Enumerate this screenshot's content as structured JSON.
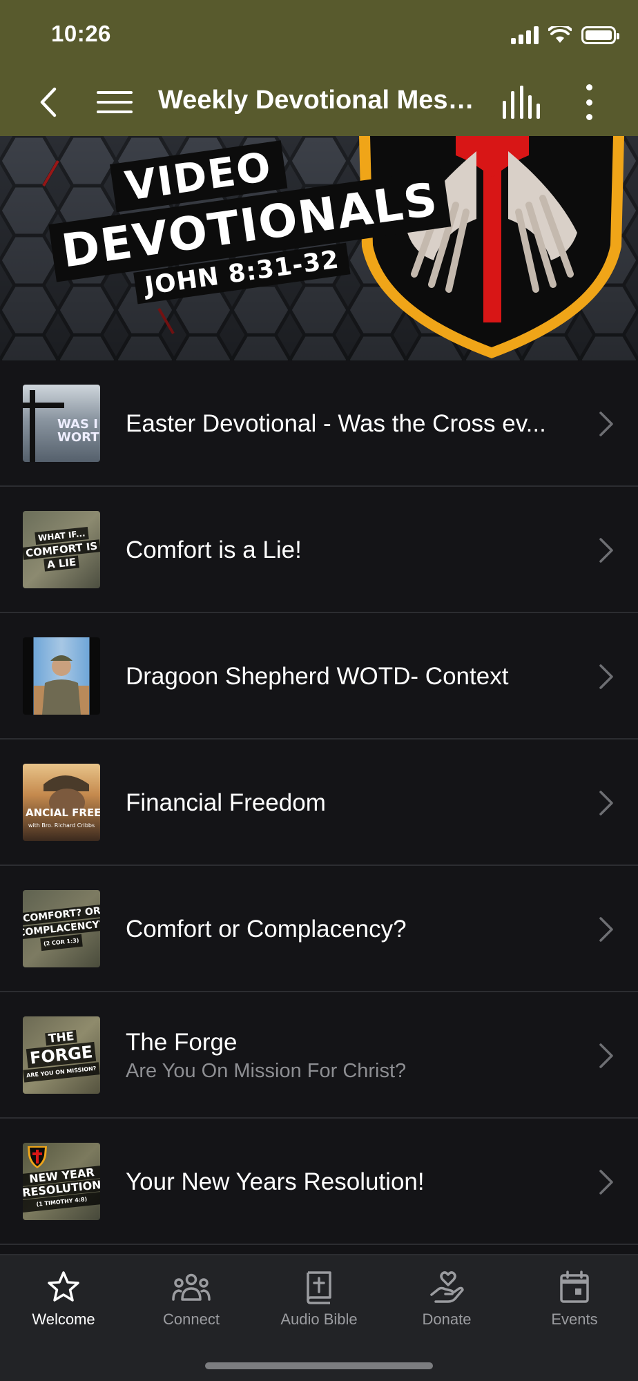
{
  "status": {
    "time": "10:26"
  },
  "nav": {
    "title": "Weekly Devotional Mess..."
  },
  "banner": {
    "line1": "VIDEO",
    "line2": "DEVOTIONALS",
    "line3": "JOHN 8:31-32"
  },
  "list": [
    {
      "title": "Easter Devotional - Was the Cross ev...",
      "subtitle": "",
      "thumb_text": [
        "WAS I",
        "WORTH"
      ]
    },
    {
      "title": "Comfort is a Lie!",
      "subtitle": "",
      "thumb_text": [
        "WHAT IF...",
        "COMFORT IS",
        "A LIE"
      ]
    },
    {
      "title": "Dragoon Shepherd WOTD- Context",
      "subtitle": "",
      "thumb_text": []
    },
    {
      "title": "Financial Freedom",
      "subtitle": "",
      "thumb_text": [
        "ANCIAL FREED",
        "with Bro. Richard Cribbs"
      ]
    },
    {
      "title": "Comfort or Complacency?",
      "subtitle": "",
      "thumb_text": [
        "COMFORT? OR",
        "COMPLACENCY?",
        "(2 COR 1:3)"
      ]
    },
    {
      "title": "The Forge",
      "subtitle": "Are You On Mission For Christ?",
      "thumb_text": [
        "THE",
        "FORGE",
        "ARE YOU ON MISSION?"
      ]
    },
    {
      "title": "Your New Years Resolution!",
      "subtitle": "",
      "thumb_text": [
        "NEW YEAR",
        "RESOLUTION",
        "(1 TIMOTHY 4:8)"
      ]
    }
  ],
  "tabs": [
    {
      "label": "Welcome",
      "icon": "star-icon",
      "active": true
    },
    {
      "label": "Connect",
      "icon": "people-icon",
      "active": false
    },
    {
      "label": "Audio Bible",
      "icon": "bible-icon",
      "active": false
    },
    {
      "label": "Donate",
      "icon": "donate-hand-heart-icon",
      "active": false
    },
    {
      "label": "Events",
      "icon": "calendar-icon",
      "active": false
    }
  ],
  "colors": {
    "header_bg": "#585a2d",
    "list_bg": "#141417",
    "tabbar_bg": "#222326",
    "tab_active": "#ffffff",
    "tab_inactive": "#9b9ca0",
    "subtitle": "#8d8e92"
  }
}
